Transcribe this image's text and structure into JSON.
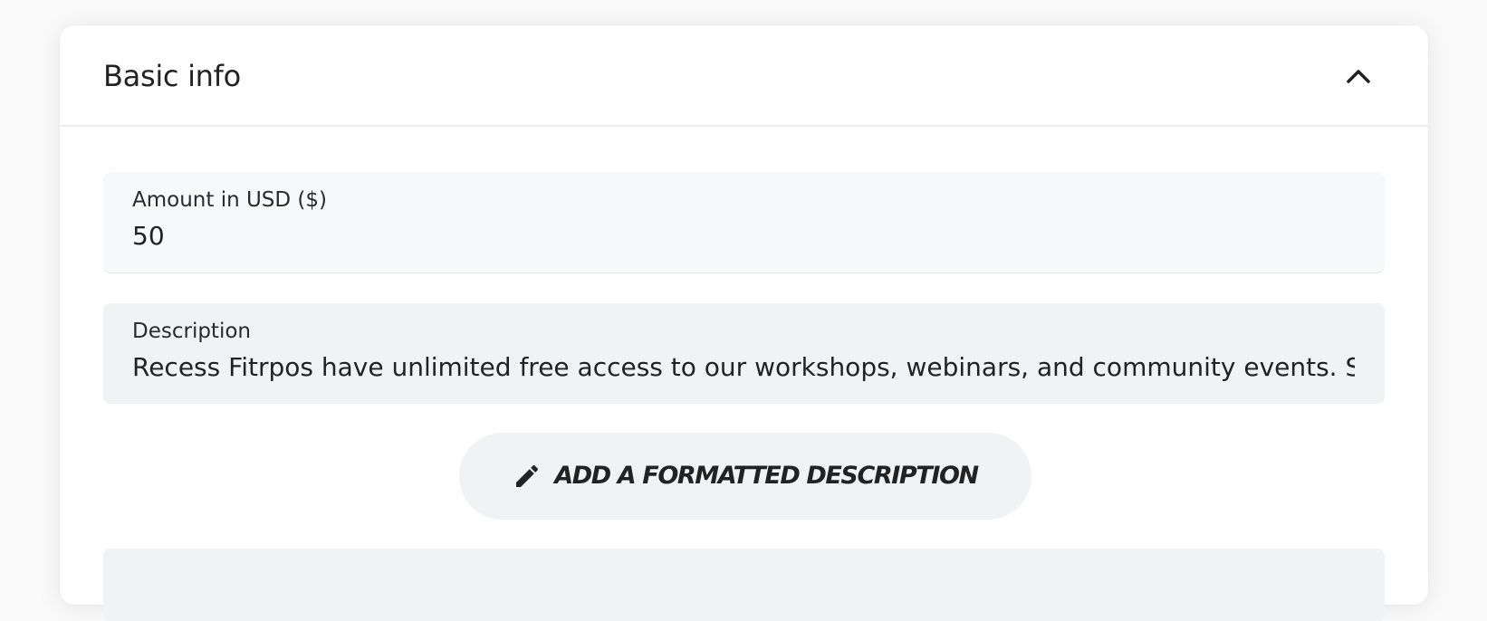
{
  "section": {
    "title": "Basic info",
    "collapse_icon": "chevron-up-icon"
  },
  "fields": {
    "amount": {
      "label": "Amount in USD ($)",
      "value": "50"
    },
    "description": {
      "label": "Description",
      "value": "Recess Fitrpos have unlimited free access to our workshops, webinars, and community events. Sign up f"
    }
  },
  "format_button": {
    "label": "ADD A FORMATTED DESCRIPTION",
    "icon": "pencil-icon"
  },
  "colors": {
    "card_background": "#ffffff",
    "field_background": "#f1f2f3",
    "text": "#222222"
  }
}
